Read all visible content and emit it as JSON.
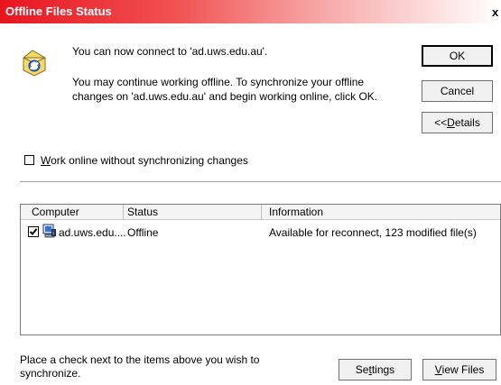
{
  "window": {
    "title": "Offline Files Status",
    "close_glyph": "x"
  },
  "message": {
    "line1": "You can now connect to 'ad.uws.edu.au'.",
    "line2": "You may continue working offline.  To synchronize your offline",
    "line3": "changes on 'ad.uws.edu.au' and begin working online, click OK."
  },
  "buttons": {
    "ok": "OK",
    "cancel": "Cancel",
    "details_prefix": "<< ",
    "details_hotkey": "D",
    "details_rest": "etails",
    "settings_prefix": "Se",
    "settings_hotkey": "t",
    "settings_rest": "tings",
    "view_hotkey": "V",
    "view_rest": "iew Files"
  },
  "work_online": {
    "hotkey": "W",
    "rest": "ork online without synchronizing changes",
    "checked": false
  },
  "table": {
    "columns": [
      "Computer",
      "Status",
      "Information"
    ],
    "rows": [
      {
        "checked": true,
        "computer": "ad.uws.edu....",
        "status": "Offline",
        "information": "Available for reconnect,  123 modified file(s)"
      }
    ]
  },
  "hint": "Place a check next to the items above you wish to synchronize.",
  "colors": {
    "title_start": "#e8151f",
    "title_end": "#ffffff"
  },
  "icons": {
    "info": "sync-folder-icon",
    "row": "computer-icon"
  }
}
